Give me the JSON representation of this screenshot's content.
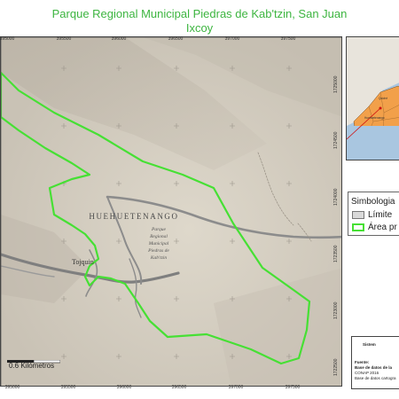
{
  "title": {
    "line1": "Parque Regional Municipal Piedras de Kab'tzin, San Juan",
    "line2": "Ixcoy"
  },
  "main_map": {
    "place_labels": {
      "department": "HUEHUETENANGO",
      "town": "Tojquin",
      "park_name_line1": "Parque",
      "park_name_line2": "Regional",
      "park_name_line3": "Municipal",
      "park_name_line4": "Piedras de",
      "park_name_line5": "Kab'tzin"
    },
    "x_ticks": [
      "395000",
      "395500",
      "396000",
      "396500",
      "397000",
      "397500",
      "398000"
    ],
    "y_ticks": [
      "1725000",
      "1724500",
      "1724000",
      "1723500",
      "1723000",
      "1722500",
      "1722000"
    ],
    "scale_label": "0.6 Kilómetros",
    "colors": {
      "protected_area": "#46e034",
      "roads": "#8c8c8c",
      "terrain": "#cfc8bb"
    }
  },
  "inset": {
    "labels": [
      "Quiché",
      "Huehuetenango"
    ]
  },
  "legend": {
    "title": "Simbologia",
    "items": [
      {
        "label": "Límite",
        "color": "#d9d9d9"
      },
      {
        "label": "Área pr",
        "color": "#46e034"
      }
    ]
  },
  "source": {
    "heading": "Sistem",
    "lines": [
      "Fuente:",
      "Base de datos de la",
      "CONAP 2016",
      "Base de datos cartogra"
    ]
  }
}
